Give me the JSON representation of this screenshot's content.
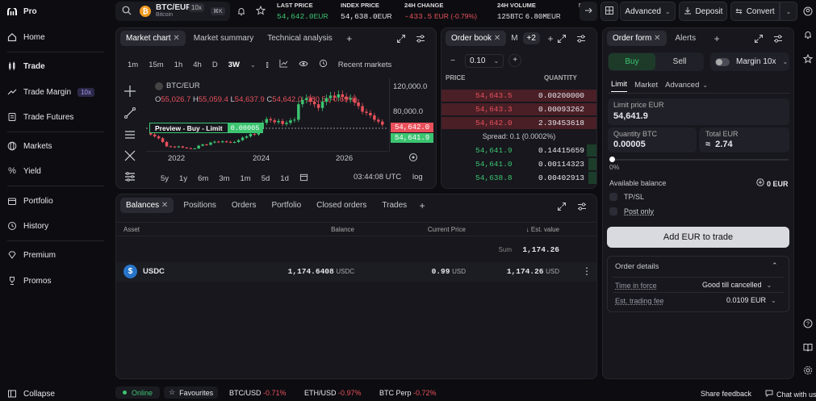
{
  "sidebar": {
    "brand": "Pro",
    "items": [
      {
        "label": "Home",
        "icon": "home-icon"
      },
      {
        "label": "Trade",
        "icon": "candles-icon"
      },
      {
        "label": "Trade Margin",
        "icon": "margin-icon",
        "badge": "10x"
      },
      {
        "label": "Trade Futures",
        "icon": "futures-icon"
      },
      {
        "label": "Markets",
        "icon": "globe-icon"
      },
      {
        "label": "Yield",
        "icon": "percent-icon"
      },
      {
        "label": "Portfolio",
        "icon": "portfolio-icon"
      },
      {
        "label": "History",
        "icon": "history-icon"
      },
      {
        "label": "Premium",
        "icon": "diamond-icon"
      },
      {
        "label": "Promos",
        "icon": "trophy-icon"
      }
    ],
    "collapse": "Collapse"
  },
  "header": {
    "pair": "BTC/EUR",
    "pair_sub": "Bitcoin",
    "leverage": "10x",
    "shortcut": "⌘K",
    "stats": [
      {
        "label": "LAST PRICE",
        "value": "54,642.0",
        "unit": "EUR"
      },
      {
        "label": "INDEX PRICE",
        "value": "54,638.0",
        "unit": "EUR"
      },
      {
        "label": "24H CHANGE",
        "value": "-433.5",
        "unit": "EUR (-0.79%)"
      },
      {
        "label": "24H VOLUME",
        "value": "125",
        "unit": "BTC",
        "value2": "6.80M",
        "unit2": "EUR"
      },
      {
        "label": "F",
        "value": "",
        "unit": ""
      }
    ],
    "advanced": "Advanced",
    "deposit": "Deposit",
    "convert": "Convert"
  },
  "chart_panel": {
    "tabs": [
      "Market chart",
      "Market summary",
      "Technical analysis"
    ],
    "intervals": [
      "1m",
      "15m",
      "1h",
      "4h",
      "D",
      "3W"
    ],
    "recent_markets": "Recent markets",
    "symbol": "BTC/EUR",
    "ohlc": {
      "o": "55,026.7",
      "h": "55,059.4",
      "l": "54,637.9",
      "c": "54,642.0",
      "chg": "-380.5 (-0.69%)"
    },
    "preview_label": "Preview - Buy - Limit",
    "preview_price": "0.00005",
    "ranges": [
      "5y",
      "1y",
      "6m",
      "3m",
      "1m",
      "5d",
      "1d"
    ],
    "clock": "03:44:08 UTC",
    "log": "log"
  },
  "chart_data": {
    "type": "candlestick",
    "x_ticks": [
      "2022",
      "2024",
      "2026"
    ],
    "y_ticks": [
      "120,000.0",
      "80,000.0"
    ],
    "price_tags": [
      "54,642.0",
      "54,641.9"
    ],
    "series": [
      {
        "o": 47000,
        "c": 39000
      },
      {
        "o": 39000,
        "c": 36000
      },
      {
        "o": 36000,
        "c": 33000
      },
      {
        "o": 33000,
        "c": 27000
      },
      {
        "o": 27000,
        "c": 20000
      },
      {
        "o": 20000,
        "c": 19500
      },
      {
        "o": 19500,
        "c": 18500
      },
      {
        "o": 18500,
        "c": 19800
      },
      {
        "o": 19800,
        "c": 18000
      },
      {
        "o": 18000,
        "c": 17000
      },
      {
        "o": 17000,
        "c": 16200
      },
      {
        "o": 16200,
        "c": 16500
      },
      {
        "o": 16500,
        "c": 21000
      },
      {
        "o": 21000,
        "c": 23000
      },
      {
        "o": 23000,
        "c": 22500
      },
      {
        "o": 22500,
        "c": 26000
      },
      {
        "o": 26000,
        "c": 27500
      },
      {
        "o": 27500,
        "c": 26800
      },
      {
        "o": 26800,
        "c": 28000
      },
      {
        "o": 28000,
        "c": 27200
      },
      {
        "o": 27200,
        "c": 26500
      },
      {
        "o": 26500,
        "c": 27000
      },
      {
        "o": 27000,
        "c": 30000
      },
      {
        "o": 30000,
        "c": 34000
      },
      {
        "o": 34000,
        "c": 36000
      },
      {
        "o": 36000,
        "c": 40000
      },
      {
        "o": 40000,
        "c": 39000
      },
      {
        "o": 39000,
        "c": 48000
      },
      {
        "o": 48000,
        "c": 58000
      },
      {
        "o": 58000,
        "c": 64000
      },
      {
        "o": 64000,
        "c": 62000
      },
      {
        "o": 62000,
        "c": 59000
      },
      {
        "o": 59000,
        "c": 61000
      },
      {
        "o": 61000,
        "c": 56000
      },
      {
        "o": 56000,
        "c": 58000
      },
      {
        "o": 58000,
        "c": 62000
      },
      {
        "o": 62000,
        "c": 63000
      },
      {
        "o": 63000,
        "c": 88000
      },
      {
        "o": 88000,
        "c": 95000
      },
      {
        "o": 95000,
        "c": 98000
      },
      {
        "o": 98000,
        "c": 92000
      },
      {
        "o": 92000,
        "c": 88000
      },
      {
        "o": 88000,
        "c": 82000
      },
      {
        "o": 82000,
        "c": 92000
      },
      {
        "o": 92000,
        "c": 98000
      },
      {
        "o": 98000,
        "c": 102000
      },
      {
        "o": 102000,
        "c": 99000
      },
      {
        "o": 99000,
        "c": 104000
      },
      {
        "o": 104000,
        "c": 100000
      },
      {
        "o": 100000,
        "c": 96000
      },
      {
        "o": 96000,
        "c": 98000
      },
      {
        "o": 98000,
        "c": 91000
      },
      {
        "o": 91000,
        "c": 85000
      },
      {
        "o": 85000,
        "c": 76000
      },
      {
        "o": 76000,
        "c": 74000
      },
      {
        "o": 74000,
        "c": 70000
      },
      {
        "o": 70000,
        "c": 63000
      },
      {
        "o": 63000,
        "c": 60000
      },
      {
        "o": 60000,
        "c": 55026.7
      }
    ],
    "ylim": [
      10000,
      130000
    ]
  },
  "orderbook": {
    "tabs": [
      "Order book",
      "M",
      "+2"
    ],
    "step": "0.10",
    "col_price": "PRICE",
    "col_qty": "QUANTITY",
    "asks": [
      {
        "price": "54,643.5",
        "qty": "0.00200000",
        "depth": 1.0
      },
      {
        "price": "54,643.3",
        "qty": "0.00093262",
        "depth": 1.0
      },
      {
        "price": "54,642.0",
        "qty": "2.39453618",
        "depth": 1.0
      }
    ],
    "spread": "Spread: 0.1 (0.0002%)",
    "bids": [
      {
        "price": "54,641.9",
        "qty": "0.14415659",
        "depth": 0.06
      },
      {
        "price": "54,641.0",
        "qty": "0.00114323",
        "depth": 0.05
      },
      {
        "price": "54,638.8",
        "qty": "0.00402913",
        "depth": 0.05
      }
    ]
  },
  "order_form": {
    "tabs": [
      "Order form",
      "Alerts"
    ],
    "buy": "Buy",
    "sell": "Sell",
    "margin": "Margin 10x",
    "types": [
      "Limit",
      "Market",
      "Advanced"
    ],
    "limit_label": "Limit price EUR",
    "limit_value": "54,641.9",
    "qty_label": "Quantity BTC",
    "qty_value": "0.00005",
    "total_label": "Total EUR",
    "total_value": "≈  2.74",
    "slider_pct": "0%",
    "available_label": "Available balance",
    "available_value": "0 EUR",
    "tpsl": "TP/SL",
    "post_only": "Post only",
    "submit": "Add EUR to trade",
    "details_title": "Order details",
    "time_in_force_label": "Time in force",
    "time_in_force_value": "Good till cancelled",
    "fee_label": "Est. trading fee",
    "fee_value": "0.0109 EUR"
  },
  "balances": {
    "tabs": [
      "Balances",
      "Positions",
      "Orders",
      "Portfolio",
      "Closed orders",
      "Trades"
    ],
    "cols": [
      "Asset",
      "Balance",
      "Current Price",
      "Est. value"
    ],
    "sum_label": "Sum",
    "sum_value": "1,174.26",
    "rows": [
      {
        "asset": "USDC",
        "balance": "1,174.6408",
        "balance_unit": "USDC",
        "price": "0.99",
        "price_unit": "USD",
        "value": "1,174.26",
        "value_unit": "USD"
      }
    ]
  },
  "footer": {
    "status": "Online",
    "favourites": "Favourites",
    "tickers": [
      {
        "pair": "BTC/USD",
        "chg": "-0.71%"
      },
      {
        "pair": "ETH/USD",
        "chg": "-0.97%"
      },
      {
        "pair": "BTC Perp",
        "chg": "-0.72%"
      }
    ],
    "share": "Share feedback",
    "chat": "Chat with us"
  },
  "colors": {
    "accent": "#7b61ff",
    "red": "#e8505b",
    "green": "#3cc471",
    "ask_bg": "#4a1f26"
  }
}
